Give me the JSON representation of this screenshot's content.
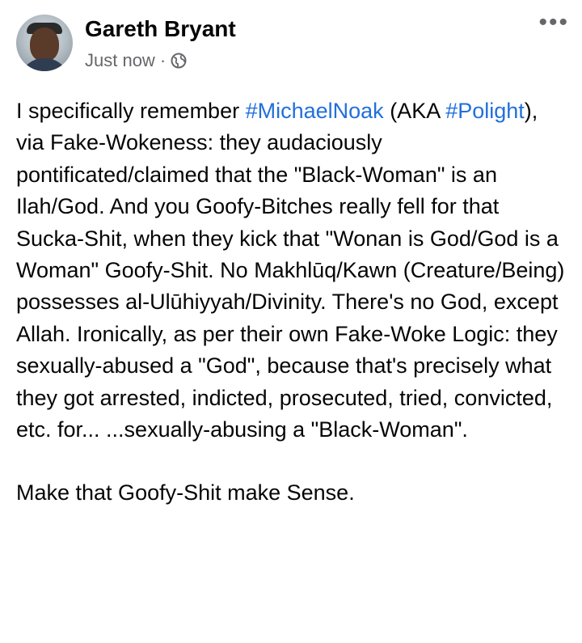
{
  "post": {
    "author": "Gareth Bryant",
    "timestamp": "Just now",
    "separator": "·",
    "more_label": "•••",
    "body": {
      "p1_a": "I specifically remember ",
      "hashtag_1": "#MichaelNoak",
      "p1_b": " (AKA ",
      "hashtag_2": "#Polight",
      "p1_c": "), via Fake-Wokeness: they audaciously pontificated/claimed that the \"Black-Woman\" is an Ilah/God. And you Goofy-Bitches really fell for that Sucka-Shit, when they kick that \"Wonan is God/God is a Woman\" Goofy-Shit. No Makhlūq/Kawn (Creature/Being) possesses al-Ulūhiyyah/Divinity. There's no God, except Allah. Ironically, as per their own Fake-Woke Logic: they sexually-abused a \"God\", because that's precisely what they got arrested, indicted, prosecuted, tried, convicted, etc. for... ...sexually-abusing a \"Black-Woman\".",
      "p2": "Make that Goofy-Shit make Sense."
    }
  },
  "colors": {
    "hashtag": "#216fdb",
    "meta": "#65676b",
    "text": "#050505"
  },
  "icons": [
    "avatar",
    "globe-icon",
    "more-options-icon"
  ]
}
